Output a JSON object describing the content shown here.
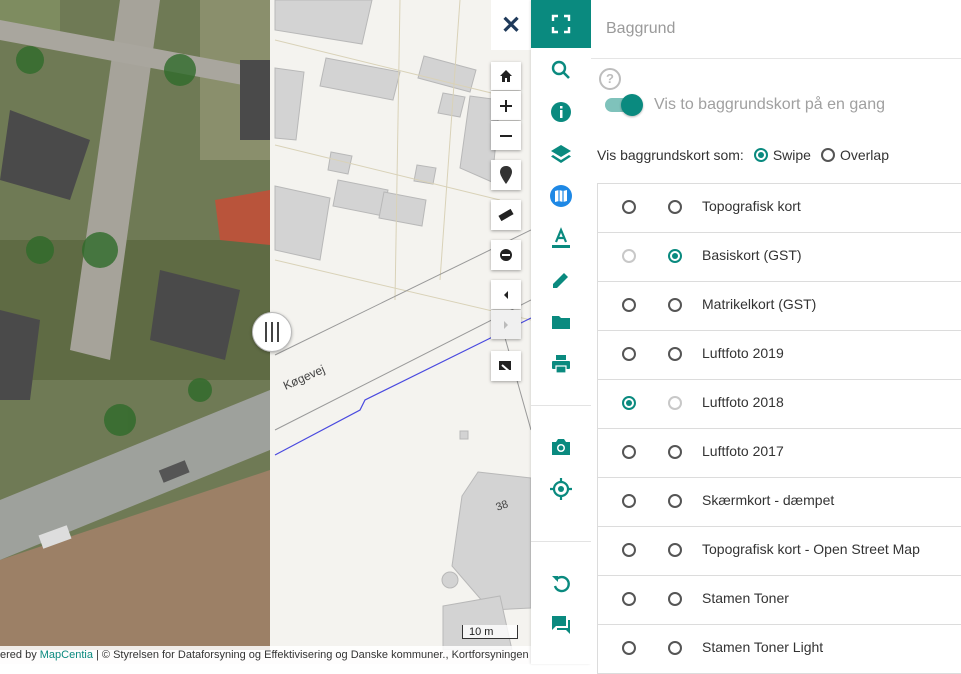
{
  "map": {
    "road_name": "Køgevej",
    "house_number": "38",
    "scale_label": "10 m",
    "attribution": {
      "prefix": "ered by ",
      "link": "MapCentia",
      "rest": " | © Styrelsen for Dataforsyning og Effektivisering og Danske kommuner., Kortforsyningen"
    },
    "controls": [
      "home-icon",
      "zoom-in-icon",
      "zoom-out-icon",
      "marker-icon",
      "ruler-icon",
      "remove-icon",
      "back-icon",
      "forward-icon",
      "screenshot-icon"
    ],
    "close_label": "✕"
  },
  "toolbar": {
    "items": [
      "fullscreen-icon",
      "search-icon",
      "info-icon",
      "layers-icon",
      "baselayer-map-icon",
      "text-icon",
      "draw-icon",
      "folder-icon",
      "print-icon",
      "camera-icon",
      "locate-icon",
      "reset-icon",
      "feedback-icon"
    ],
    "accent": "#0a8a7f"
  },
  "panel": {
    "title": "Baggrund",
    "help_symbol": "?",
    "toggle_label": "Vis to baggrundskort på en gang",
    "toggle_on": true,
    "mode_label": "Vis baggrundskort som:",
    "modes": [
      {
        "label": "Swipe",
        "selected": true
      },
      {
        "label": "Overlap",
        "selected": false
      }
    ],
    "layers": [
      {
        "name": "Topografisk kort",
        "left": false,
        "right": false
      },
      {
        "name": "Basiskort (GST)",
        "left": false,
        "right": true
      },
      {
        "name": "Matrikelkort (GST)",
        "left": false,
        "right": false
      },
      {
        "name": "Luftfoto 2019",
        "left": false,
        "right": false
      },
      {
        "name": "Luftfoto 2018",
        "left": true,
        "right": false
      },
      {
        "name": "Luftfoto 2017",
        "left": false,
        "right": false
      },
      {
        "name": "Skærmkort - dæmpet",
        "left": false,
        "right": false
      },
      {
        "name": "Topografisk kort - Open Street Map",
        "left": false,
        "right": false
      },
      {
        "name": "Stamen Toner",
        "left": false,
        "right": false
      },
      {
        "name": "Stamen Toner Light",
        "left": false,
        "right": false
      }
    ]
  }
}
